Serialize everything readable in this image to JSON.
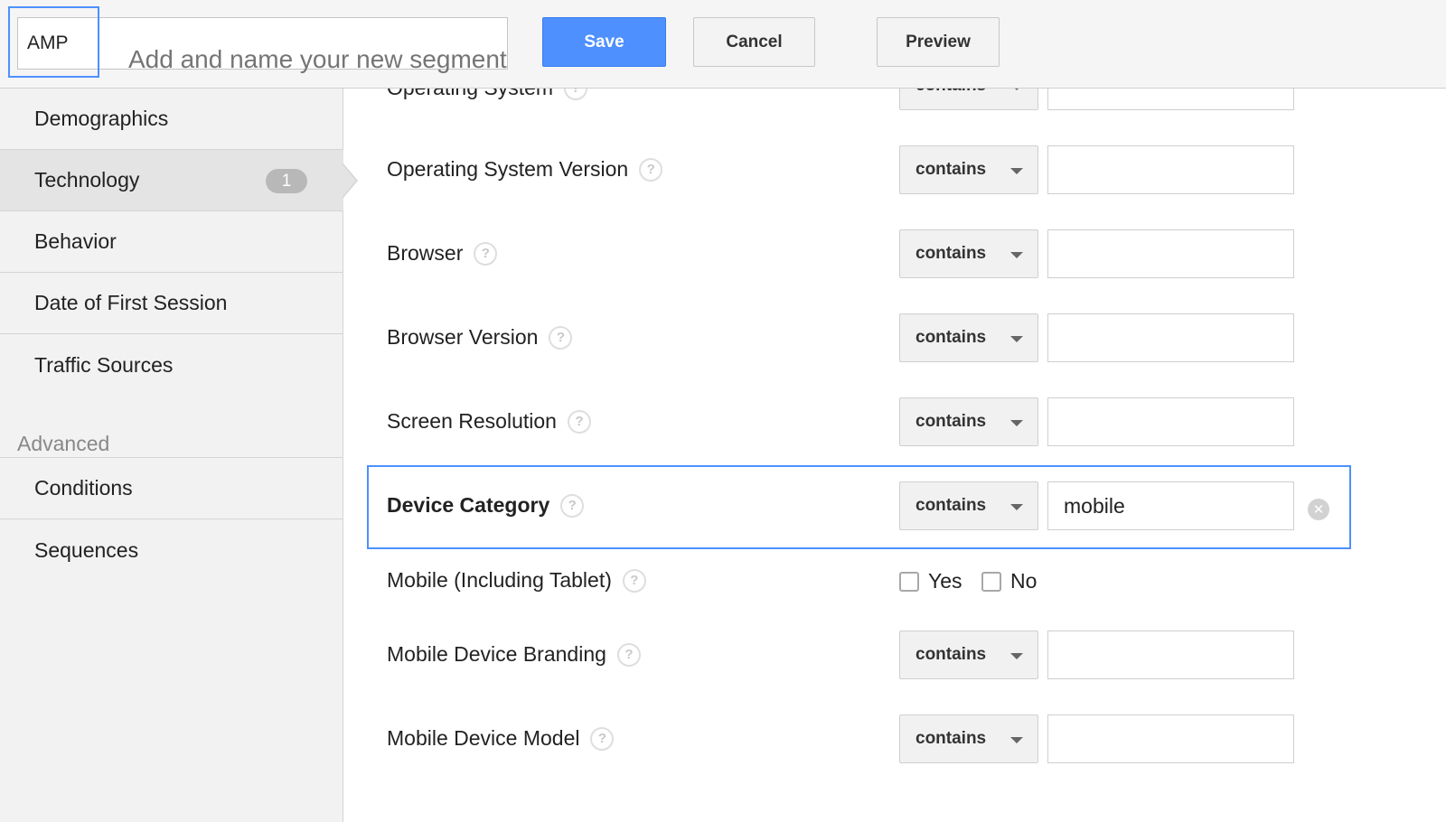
{
  "header": {
    "segment_prefix": "AMP",
    "segment_name_placeholder": "Add and name your new segment",
    "save_label": "Save",
    "cancel_label": "Cancel",
    "preview_label": "Preview"
  },
  "sidebar": {
    "items": [
      {
        "label": "Demographics"
      },
      {
        "label": "Technology",
        "badge": "1",
        "active": true
      },
      {
        "label": "Behavior"
      },
      {
        "label": "Date of First Session"
      },
      {
        "label": "Traffic Sources"
      }
    ],
    "advanced_heading": "Advanced",
    "advanced_items": [
      {
        "label": "Conditions"
      },
      {
        "label": "Sequences"
      }
    ]
  },
  "filters": {
    "help_glyph": "?",
    "operator_default": "contains",
    "clear_glyph": "✕",
    "rows": [
      {
        "label": "Operating System",
        "operator": "contains",
        "value": ""
      },
      {
        "label": "Operating System Version",
        "operator": "contains",
        "value": ""
      },
      {
        "label": "Browser",
        "operator": "contains",
        "value": ""
      },
      {
        "label": "Browser Version",
        "operator": "contains",
        "value": ""
      },
      {
        "label": "Screen Resolution",
        "operator": "contains",
        "value": ""
      },
      {
        "label": "Device Category",
        "operator": "contains",
        "value": "mobile",
        "selected": true
      },
      {
        "label": "Mobile (Including Tablet)",
        "options": [
          "Yes",
          "No"
        ]
      },
      {
        "label": "Mobile Device Branding",
        "operator": "contains",
        "value": ""
      },
      {
        "label": "Mobile Device Model",
        "operator": "contains",
        "value": ""
      }
    ]
  },
  "colors": {
    "accent": "#4d90fe",
    "segment_name_text": "#2d8ce6",
    "sidebar_bg": "#f2f2f2",
    "sidebar_active_bg": "#e4e4e4"
  }
}
